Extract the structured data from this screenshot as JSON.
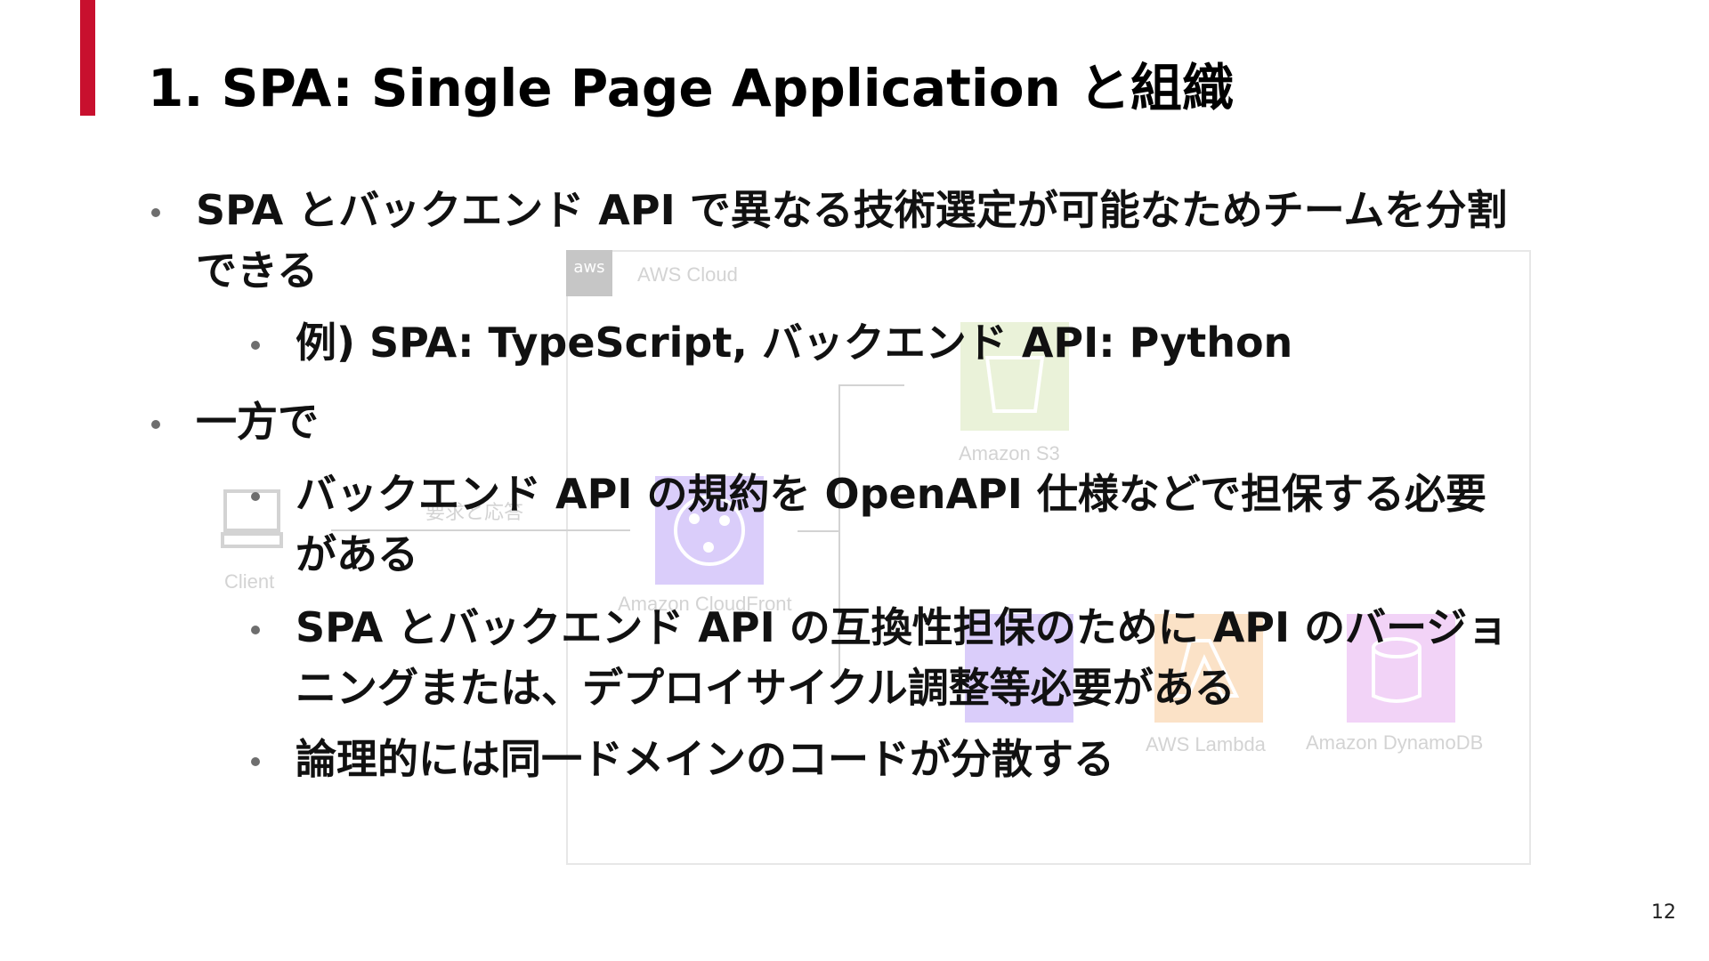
{
  "title": "1. SPA: Single Page Application と組織",
  "slide_number": "12",
  "colors": {
    "accent": "#c8102e"
  },
  "bullets": {
    "b1_line1": "SPA とバックエンド API で異なる技術選定が可能なためチームを分割",
    "b1_line2": "できる",
    "b1_sub1": "例) SPA: TypeScript, バックエンド API: Python",
    "b2": "一方で",
    "b2_sub1_line1": "バックエンド API の規約を OpenAPI 仕様などで担保する必要",
    "b2_sub1_line2": "がある",
    "b2_sub2_line1": "SPA とバックエンド API の互換性担保のために API のバージョ",
    "b2_sub2_line2": "ニングまたは、デプロイサイクル調整等必要がある",
    "b2_sub3": "論理的には同一ドメインのコードが分散する"
  },
  "diagram": {
    "aws_badge": "aws",
    "cloud_label": "AWS Cloud",
    "client_label": "Client",
    "request_label": "要求と応答",
    "services": {
      "s3": "Amazon S3",
      "cloudfront": "Amazon CloudFront",
      "lambda": "AWS Lambda",
      "dynamodb": "Amazon DynamoDB"
    },
    "icons": [
      "client-computer-icon",
      "s3-bucket-icon",
      "cloudfront-icon",
      "api-gateway-icon",
      "lambda-icon",
      "dynamodb-icon"
    ]
  }
}
